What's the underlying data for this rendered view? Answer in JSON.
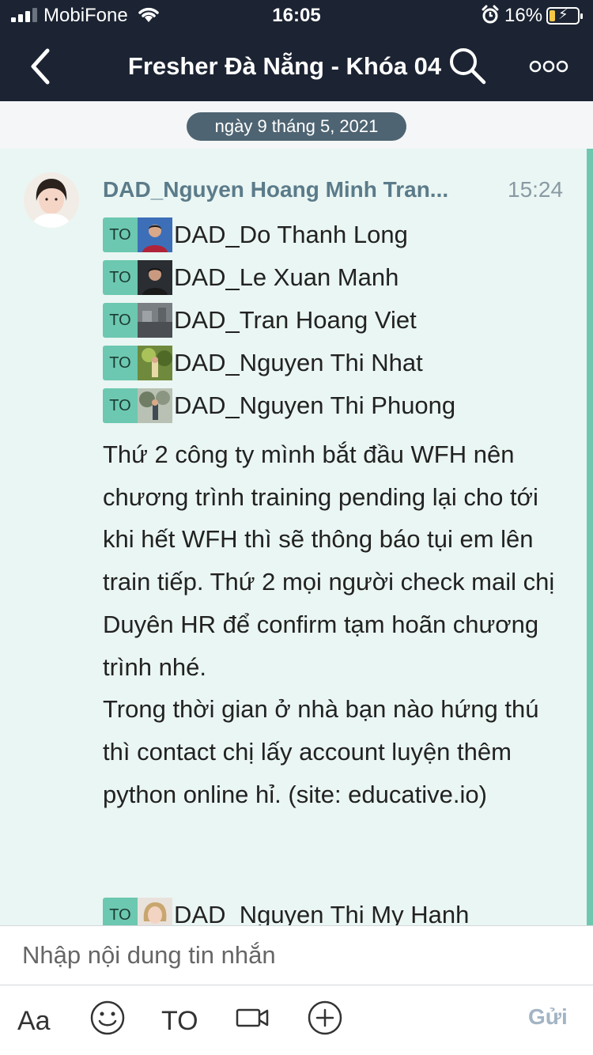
{
  "status_bar": {
    "carrier": "MobiFone",
    "time": "16:05",
    "battery": "16%",
    "battery_level": 0.16
  },
  "header": {
    "title": "Fresher Đà Nẵng - Khóa 04"
  },
  "date_separator": "ngày 9 tháng 5, 2021",
  "message": {
    "sender": "DAD_Nguyen Hoang Minh Tran...",
    "time": "15:24",
    "mention_tag": "TO",
    "mentions": [
      "DAD_Do Thanh Long",
      "DAD_Le Xuan Manh",
      "DAD_Tran Hoang Viet",
      "DAD_Nguyen Thi Nhat",
      "DAD_Nguyen Thi Phuong"
    ],
    "body": "Thứ 2 công ty mình bắt đầu WFH nên chương trình training pending lại cho tới khi hết WFH thì sẽ thông báo tụi em lên train tiếp. Thứ 2 mọi người check mail chị Duyên HR để confirm tạm hoãn chương trình nhé.\nTrong thời gian ở nhà bạn nào hứng thú thì contact chị lấy account luyện thêm python online hỉ. (site: educative.io)",
    "next_mention": "DAD_Nguyen Thi My Hanh"
  },
  "composer": {
    "placeholder": "Nhập nội dung tin nhắn",
    "font_button": "Aa",
    "mention_button": "TO",
    "send_label": "Gửi"
  },
  "colors": {
    "header_bg": "#1c2433",
    "chat_bg": "#eaf6f3",
    "mention_tag": "#6cc8b0",
    "sender_name": "#5b7b8a",
    "date_pill": "#4e6472",
    "send_disabled": "#a3b4c4"
  }
}
